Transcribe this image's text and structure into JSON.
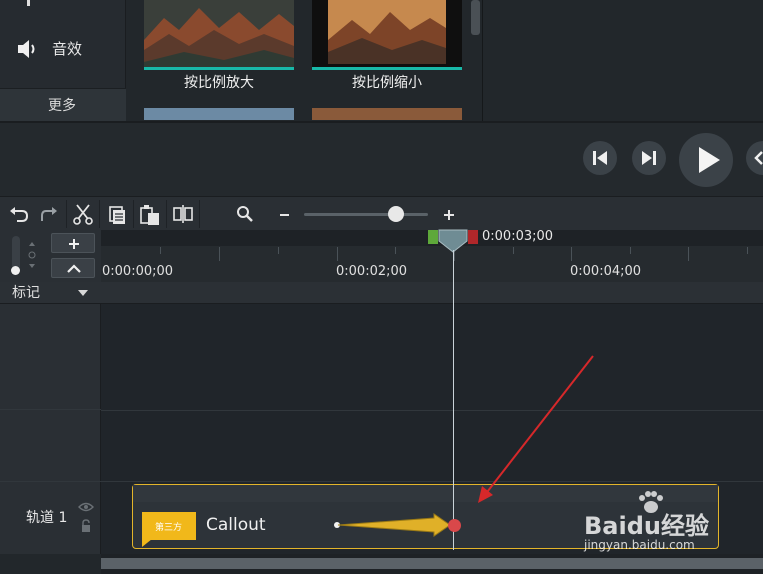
{
  "library": {
    "nav": {
      "audio_label": "音效",
      "more_label": "更多"
    },
    "thumbnails": [
      {
        "label": "按比例放大"
      },
      {
        "label": "按比例缩小"
      }
    ]
  },
  "timeline": {
    "playhead_time": "0:00:03;00",
    "ruler_labels": [
      "0:00:00;00",
      "0:00:02;00",
      "0:00:04;00"
    ],
    "markers_label": "标记",
    "track_label": "轨道 1",
    "clip": {
      "tag_text": "第三方",
      "name": "Callout"
    }
  },
  "watermark": {
    "brand": "Baidu经验",
    "url": "jingyan.baidu.com"
  },
  "colors": {
    "accent_teal": "#18b8a8",
    "clip_border": "#e3b52a",
    "callout_yellow": "#f1b81a",
    "annotation_red": "#d6282a"
  }
}
